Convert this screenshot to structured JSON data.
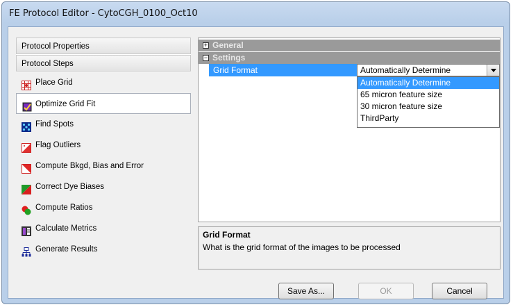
{
  "window": {
    "title": "FE Protocol Editor - CytoCGH_0100_Oct10"
  },
  "left": {
    "sections": [
      "Protocol Properties",
      "Protocol Steps"
    ],
    "steps": [
      {
        "label": "Place Grid",
        "icon": "place-grid-icon"
      },
      {
        "label": "Optimize Grid Fit",
        "icon": "optimize-grid-icon"
      },
      {
        "label": "Find Spots",
        "icon": "find-spots-icon"
      },
      {
        "label": "Flag Outliers",
        "icon": "flag-outliers-icon"
      },
      {
        "label": "Compute Bkgd, Bias and Error",
        "icon": "compute-bkgd-icon"
      },
      {
        "label": "Correct Dye Biases",
        "icon": "correct-dye-icon"
      },
      {
        "label": "Compute Ratios",
        "icon": "compute-ratios-icon"
      },
      {
        "label": "Calculate Metrics",
        "icon": "calculate-metrics-icon"
      },
      {
        "label": "Generate Results",
        "icon": "generate-results-icon"
      }
    ],
    "selected_step": "Optimize Grid Fit"
  },
  "grid": {
    "categories": [
      {
        "label": "General",
        "expander": "⊞"
      },
      {
        "label": "Settings",
        "expander": "⊟"
      }
    ],
    "property": {
      "name": "Grid Format",
      "value": "Automatically Determine"
    },
    "dropdown_options": [
      "Automatically Determine",
      "65 micron feature size",
      "30 micron feature size",
      "ThirdParty"
    ]
  },
  "help": {
    "title": "Grid Format",
    "description": "What is the grid format of the images to be processed"
  },
  "buttons": {
    "save_as": "Save As...",
    "ok": "OK",
    "cancel": "Cancel"
  },
  "colors": {
    "selection": "#3399ff",
    "category_header": "#9a9a9a"
  }
}
